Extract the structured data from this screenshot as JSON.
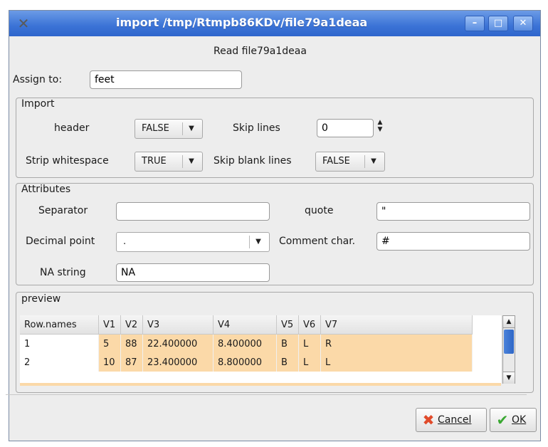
{
  "window": {
    "title": "import /tmp/Rtmpb86KDv/file79a1deaa",
    "app_icon": "x-icon",
    "controls": [
      "minimize-icon",
      "maximize-icon",
      "close-icon"
    ]
  },
  "read_label": "Read file79a1deaa",
  "assign": {
    "label": "Assign to:",
    "value": "feet"
  },
  "import": {
    "legend": "Import",
    "header_label": "header",
    "header_value": "FALSE",
    "skip_lines_label": "Skip lines",
    "skip_lines_value": "0",
    "strip_label": "Strip whitespace",
    "strip_value": "TRUE",
    "skip_blank_label": "Skip blank lines",
    "skip_blank_value": "FALSE"
  },
  "attributes": {
    "legend": "Attributes",
    "separator_label": "Separator",
    "separator_value": "",
    "quote_label": "quote",
    "quote_value": "\"",
    "decimal_label": "Decimal point",
    "decimal_value": ".",
    "comment_label": "Comment char.",
    "comment_value": "#",
    "na_label": "NA string",
    "na_value": "NA"
  },
  "preview": {
    "legend": "preview",
    "columns": [
      "Row.names",
      "V1",
      "V2",
      "V3",
      "V4",
      "V5",
      "V6",
      "V7"
    ],
    "rows": [
      [
        "1",
        "5",
        "88",
        "22.400000",
        "8.400000",
        "B",
        "L",
        "R"
      ],
      [
        "2",
        "10",
        "87",
        "23.400000",
        "8.800000",
        "B",
        "L",
        "L"
      ]
    ]
  },
  "buttons": {
    "cancel": "Cancel",
    "ok": "OK"
  },
  "colors": {
    "titlebar": "#3b73d6",
    "preview_cells": "#fbd9a8",
    "cancel_icon": "#e04a2a",
    "ok_icon": "#3aa832"
  }
}
